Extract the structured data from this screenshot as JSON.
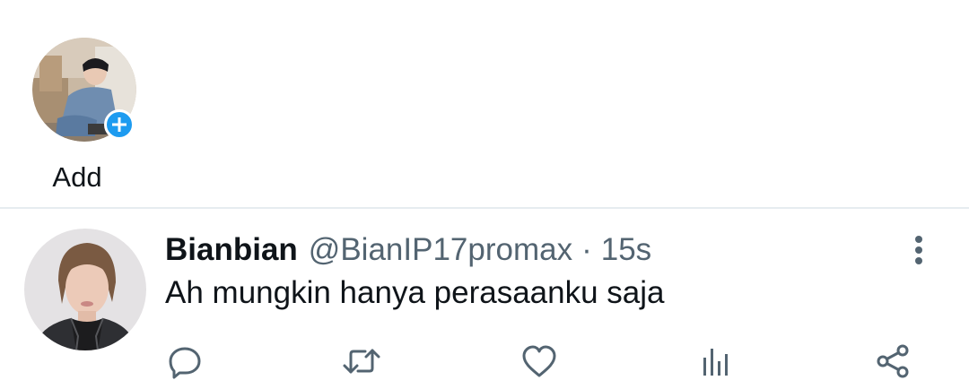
{
  "fleets": {
    "add_label": "Add",
    "add_icon": "plus-icon",
    "accent_color": "#1d9bf0"
  },
  "tweet": {
    "display_name": "Bianbian",
    "handle": "@BianIP17promax",
    "separator": "·",
    "timestamp": "15s",
    "text": "Ah mungkin hanya perasaanku saja",
    "more_icon": "more-vertical-icon",
    "actions": [
      {
        "name": "reply",
        "icon": "reply-icon"
      },
      {
        "name": "retweet",
        "icon": "retweet-icon"
      },
      {
        "name": "like",
        "icon": "heart-icon"
      },
      {
        "name": "analytics",
        "icon": "analytics-icon"
      },
      {
        "name": "share",
        "icon": "share-icon"
      }
    ]
  },
  "colors": {
    "text_primary": "#0f1419",
    "text_secondary": "#536471",
    "divider": "#e6ecf0",
    "icon": "#536471"
  }
}
